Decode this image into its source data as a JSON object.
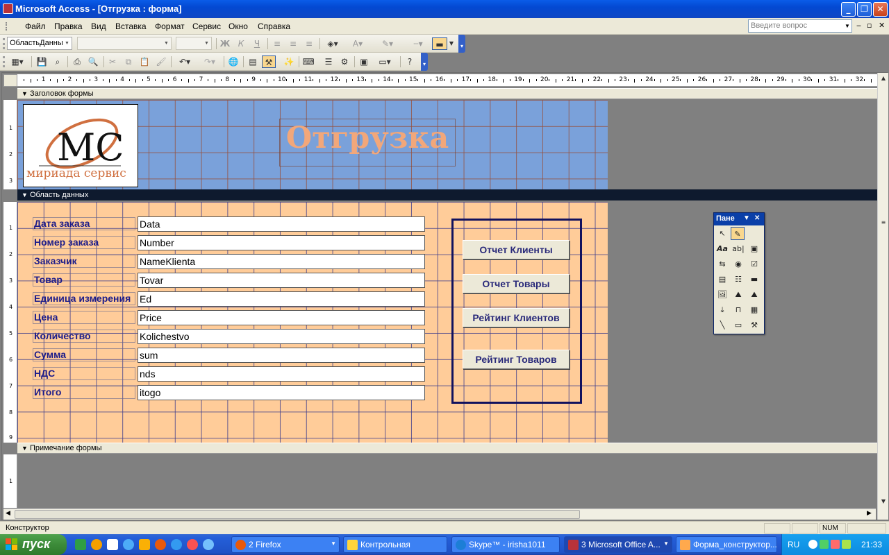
{
  "window": {
    "title": "Microsoft Access - [Отгрузка : форма]",
    "minimize_glyph": "_",
    "restore_glyph": "❐",
    "close_glyph": "✕"
  },
  "menu": {
    "items": [
      "Файл",
      "Правка",
      "Вид",
      "Вставка",
      "Формат",
      "Сервис",
      "Окно",
      "Справка"
    ],
    "ask_placeholder": "Введите вопрос"
  },
  "format_toolbar": {
    "object_combo": "ОбластьДанны",
    "font_combo": "",
    "size_combo": "",
    "bold": "Ж",
    "italic": "К",
    "underline": "Ч",
    "font_color_letter": "A"
  },
  "ruler": {
    "numbers": [
      "1",
      "2",
      "3",
      "4",
      "5",
      "6",
      "7",
      "8",
      "9",
      "10",
      "11",
      "12",
      "13",
      "14",
      "15",
      "16",
      "17",
      "18",
      "19",
      "20",
      "21",
      "22",
      "23",
      "24",
      "25",
      "26",
      "27",
      "28",
      "29",
      "30",
      "31",
      "32"
    ],
    "left_header": [
      "1",
      "2",
      "3"
    ],
    "left_detail": [
      "1",
      "2",
      "3",
      "4",
      "5",
      "6",
      "7",
      "8",
      "9"
    ],
    "left_footer": [
      "1"
    ]
  },
  "sections": {
    "header": "Заголовок формы",
    "detail": "Область данных",
    "footer": "Примечание формы"
  },
  "form": {
    "heading": "Отгрузка",
    "logo_text": "мириада сервис",
    "logo_monogram": "MC",
    "fields": [
      {
        "label": "Дата заказа",
        "control": "Data"
      },
      {
        "label": "Номер заказа",
        "control": "Number"
      },
      {
        "label": "Заказчик",
        "control": "NameKlienta"
      },
      {
        "label": "Товар",
        "control": "Tovar"
      },
      {
        "label": "Единица измерения",
        "control": "Ed"
      },
      {
        "label": "Цена",
        "control": "Price"
      },
      {
        "label": "Количество",
        "control": "Kolichestvo"
      },
      {
        "label": "Сумма",
        "control": "sum"
      },
      {
        "label": "НДС",
        "control": "nds"
      },
      {
        "label": "Итого",
        "control": "itogo"
      }
    ],
    "buttons": [
      "Отчет Клиенты",
      "Отчет Товары",
      "Рейтинг Клиентов",
      "Рейтинг Товаров"
    ]
  },
  "toolbox": {
    "title": "Пане",
    "tools": [
      "pointer-icon",
      "wizard-icon",
      "label-icon",
      "textbox-icon",
      "option-group-icon",
      "toggle-icon",
      "radio-icon",
      "checkbox-icon",
      "combobox-icon",
      "listbox-icon",
      "command-button-icon",
      "image-icon",
      "unbound-frame-icon",
      "bound-frame-icon",
      "page-break-icon",
      "tab-control-icon",
      "subform-icon",
      "line-icon",
      "rectangle-icon",
      "more-controls-icon"
    ],
    "textbox_glyph": "ab|",
    "label_glyph": "Aa"
  },
  "status": {
    "text": "Конструктор",
    "num": "NUM"
  },
  "taskbar": {
    "start": "пуск",
    "tasks": [
      "2 Firefox",
      "Контрольная",
      "Skype™ - irisha1011",
      "3 Microsoft Office A...",
      "Форма_конструктор..."
    ],
    "lang": "RU",
    "clock": "21:33"
  },
  "colors": {
    "header_grid": "#7aa1da",
    "detail_grid": "#ffcc99",
    "heading_text": "#f2a77a",
    "label_text": "#1c1c8a"
  }
}
